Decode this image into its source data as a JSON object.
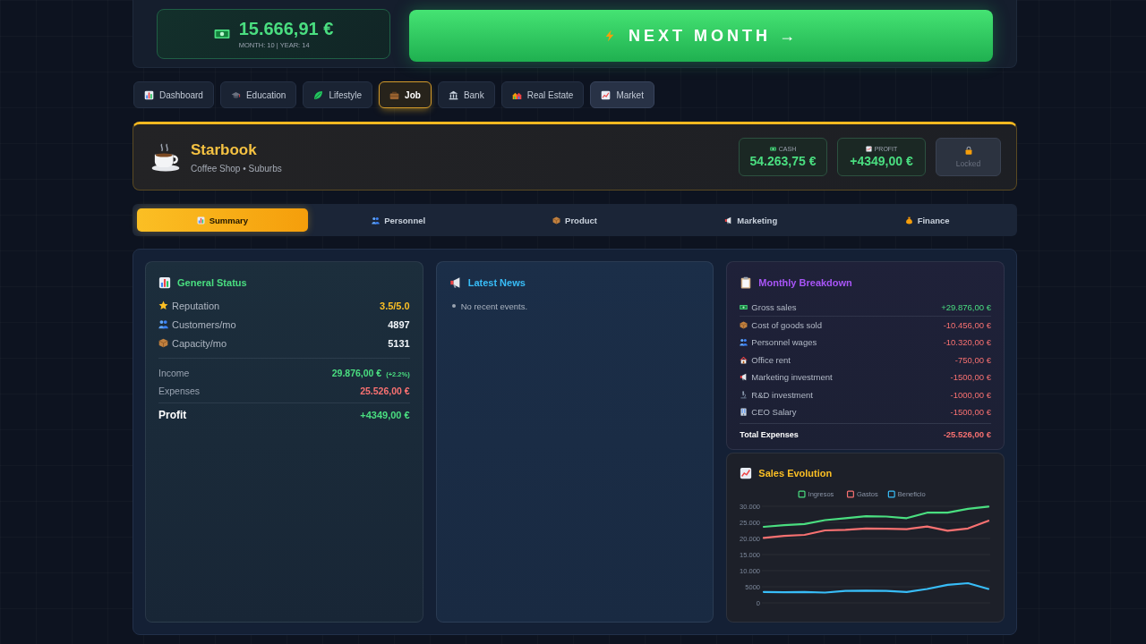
{
  "cash": {
    "amount": "15.666,91 €",
    "period": "MONTH: 10 | YEAR: 14"
  },
  "next_button": {
    "label": "NEXT MONTH →"
  },
  "nav_tabs": [
    {
      "label": "Dashboard",
      "selected": false,
      "hovered": false
    },
    {
      "label": "Education",
      "selected": false,
      "hovered": false
    },
    {
      "label": "Lifestyle",
      "selected": false,
      "hovered": false
    },
    {
      "label": "Job",
      "selected": true,
      "hovered": false
    },
    {
      "label": "Bank",
      "selected": false,
      "hovered": false
    },
    {
      "label": "Real Estate",
      "selected": false,
      "hovered": false
    },
    {
      "label": "Market",
      "selected": false,
      "hovered": true
    }
  ],
  "business": {
    "name": "Starbook",
    "subtitle": "Coffee Shop • Suburbs",
    "stats": [
      {
        "label": "CASH",
        "value": "54.263,75 €"
      },
      {
        "label": "PROFIT",
        "value": "+4349,00 €"
      }
    ],
    "lock_button": {
      "label": "Locked",
      "disabled": true
    }
  },
  "sub_tabs": [
    {
      "label": "Summary",
      "selected": true
    },
    {
      "label": "Personnel",
      "selected": false
    },
    {
      "label": "Product",
      "selected": false
    },
    {
      "label": "Marketing",
      "selected": false
    },
    {
      "label": "Finance",
      "selected": false
    }
  ],
  "general_status": {
    "title": "General Status",
    "metrics": [
      {
        "label": "Reputation",
        "value": "3.5/5.0",
        "kind": "rating"
      },
      {
        "label": "Customers/mo",
        "value": "4897",
        "kind": "count"
      },
      {
        "label": "Capacity/mo",
        "value": "5131",
        "kind": "count"
      }
    ],
    "finance": [
      {
        "label": "Income",
        "value": "29.876,00 €",
        "change": "(+2.2%)",
        "kind": "income"
      },
      {
        "label": "Expenses",
        "value": "25.526,00 €",
        "kind": "expense"
      }
    ],
    "profit": {
      "label": "Profit",
      "value": "+4349,00 €"
    }
  },
  "news": {
    "title": "Latest News",
    "items": [
      "No recent events."
    ]
  },
  "breakdown": {
    "title": "Monthly Breakdown",
    "items": [
      {
        "label": "Gross sales",
        "value": "+29.876,00 €",
        "kind": "income"
      },
      {
        "label": "Cost of goods sold",
        "value": "-10.456,00 €",
        "kind": "expense"
      },
      {
        "label": "Personnel wages",
        "value": "-10.320,00 €",
        "kind": "expense"
      },
      {
        "label": "Office rent",
        "value": "-750,00 €",
        "kind": "expense"
      },
      {
        "label": "Marketing investment",
        "value": "-1500,00 €",
        "kind": "expense"
      },
      {
        "label": "R&D investment",
        "value": "-1000,00 €",
        "kind": "expense"
      },
      {
        "label": "CEO Salary",
        "value": "-1500,00 €",
        "kind": "expense"
      }
    ],
    "total": {
      "label": "Total Expenses",
      "value": "-25.526,00 €"
    }
  },
  "sales": {
    "title": "Sales Evolution",
    "chart_data": {
      "type": "line",
      "grid": true,
      "legend": "top",
      "ylim": [
        0,
        30000
      ],
      "yticks": [
        {
          "value": 0,
          "label": "0"
        },
        {
          "value": 5000,
          "label": "5000"
        },
        {
          "value": 10000,
          "label": "10.000"
        },
        {
          "value": 15000,
          "label": "15.000"
        },
        {
          "value": 20000,
          "label": "20.000"
        },
        {
          "value": 25000,
          "label": "25.000"
        },
        {
          "value": 30000,
          "label": "30.000"
        }
      ],
      "series": [
        {
          "name": "Ingresos",
          "color": "#4ade80",
          "values": [
            23600,
            24100,
            24500,
            25700,
            26300,
            26900,
            26800,
            26300,
            28000,
            28000,
            29200,
            29900
          ]
        },
        {
          "name": "Gastos",
          "color": "#f87171",
          "values": [
            20200,
            20800,
            21100,
            22500,
            22700,
            23100,
            23000,
            22900,
            23700,
            22400,
            23100,
            25500
          ]
        },
        {
          "name": "Beneficio",
          "color": "#38bdf8",
          "values": [
            3400,
            3300,
            3400,
            3200,
            3700,
            3800,
            3700,
            3400,
            4300,
            5600,
            6100,
            4300
          ]
        }
      ]
    }
  }
}
